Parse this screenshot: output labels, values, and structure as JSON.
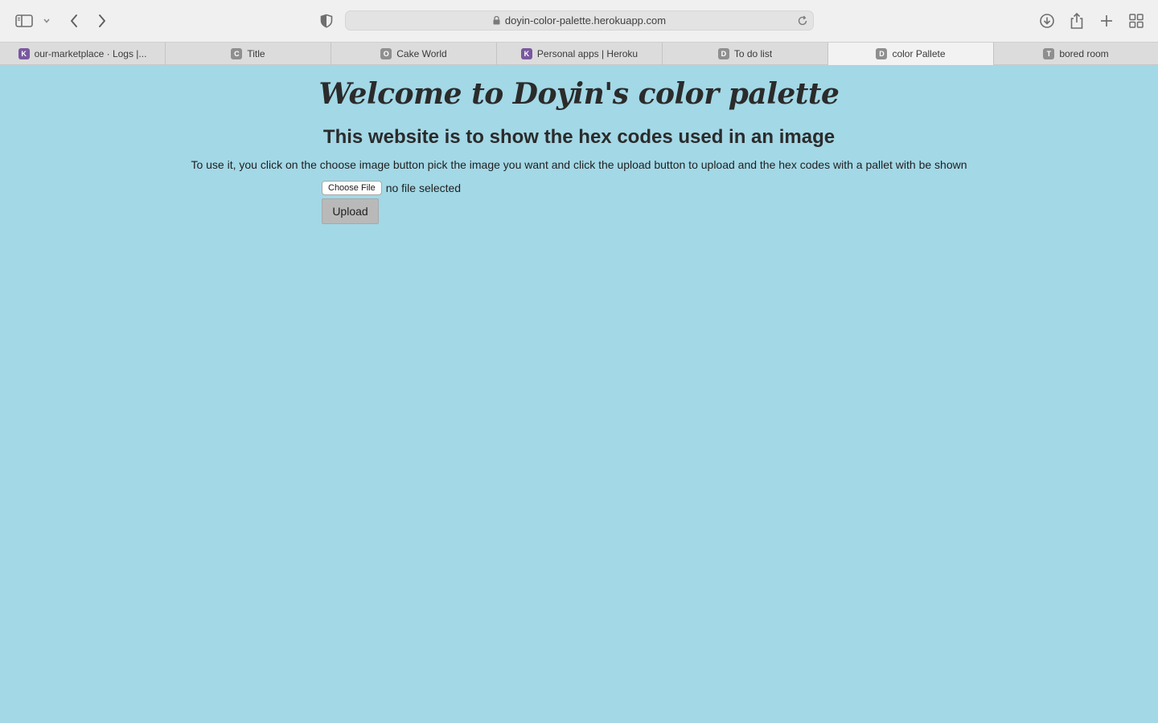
{
  "browser": {
    "url": "doyin-color-palette.herokuapp.com",
    "tabs": [
      {
        "title": "our-marketplace · Logs |...",
        "favicon": "K",
        "favicon_style": "heroku",
        "active": false
      },
      {
        "title": "Title",
        "favicon": "C",
        "favicon_style": "grey",
        "active": false
      },
      {
        "title": "Cake World",
        "favicon": "O",
        "favicon_style": "grey",
        "active": false
      },
      {
        "title": "Personal apps | Heroku",
        "favicon": "K",
        "favicon_style": "heroku",
        "active": false
      },
      {
        "title": "To do list",
        "favicon": "D",
        "favicon_style": "grey",
        "active": false
      },
      {
        "title": "color Pallete",
        "favicon": "D",
        "favicon_style": "grey",
        "active": true
      },
      {
        "title": "bored room",
        "favicon": "T",
        "favicon_style": "grey",
        "active": false
      }
    ],
    "icons": {
      "sidebar": "sidebar-icon",
      "back": "chevron-left-icon",
      "forward": "chevron-right-icon",
      "privacy": "shield-icon",
      "lock": "lock-icon",
      "reload": "reload-icon",
      "download": "download-icon",
      "share": "share-icon",
      "new_tab": "plus-icon",
      "tab_overview": "grid-icon"
    }
  },
  "page": {
    "title": "Welcome to Doyin's color palette",
    "subtitle": "This website is to show the hex codes used in an image",
    "instructions": "To use it, you click on the choose image button pick the image you want and click the upload button to upload and the hex codes with a pallet with be shown",
    "choose_file_label": "Choose File",
    "file_status": "no file selected",
    "upload_label": "Upload"
  },
  "colors": {
    "page_background": "#a3d8e6",
    "toolbar_background": "#f0f0f0",
    "heroku_purple": "#79589f"
  }
}
